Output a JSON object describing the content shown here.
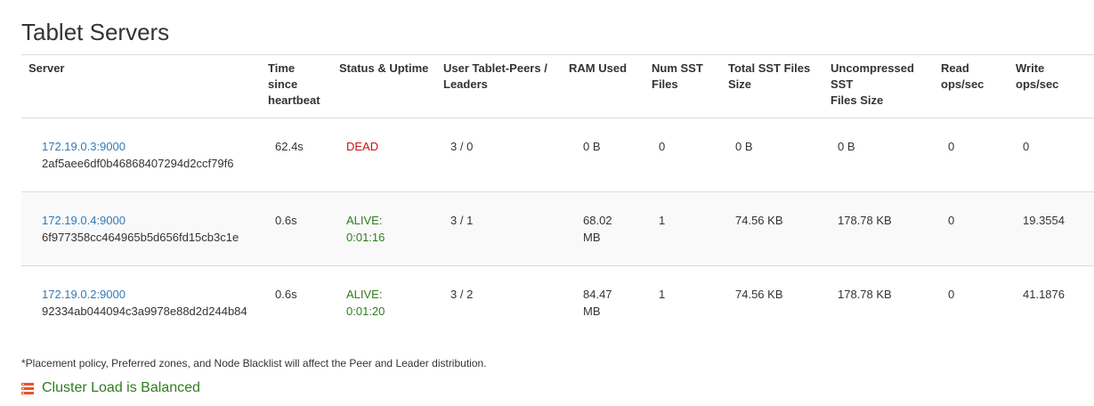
{
  "page": {
    "title": "Tablet Servers"
  },
  "table": {
    "headers": {
      "server": "Server",
      "heartbeat_1": "Time",
      "heartbeat_2": "since",
      "heartbeat_3": "heartbeat",
      "status": "Status & Uptime",
      "peers_1": "User Tablet-Peers /",
      "peers_2": "Leaders",
      "ram": "RAM Used",
      "num_sst_1": "Num SST",
      "num_sst_2": "Files",
      "total_sst_1": "Total SST Files",
      "total_sst_2": "Size",
      "uncomp_1": "Uncompressed",
      "uncomp_2": "SST",
      "uncomp_3": "Files Size",
      "read_1": "Read",
      "read_2": "ops/sec",
      "write_1": "Write",
      "write_2": "ops/sec"
    },
    "rows": [
      {
        "address": "172.19.0.3:9000",
        "uuid": "2af5aee6df0b46868407294d2ccf79f6",
        "heartbeat": "62.4s",
        "status_1": "DEAD",
        "status_2": "",
        "peers": "3 / 0",
        "ram_1": "0 B",
        "ram_2": "",
        "num_sst": "0",
        "total_sst": "0 B",
        "uncompressed": "0 B",
        "read_ops": "0",
        "write_ops": "0"
      },
      {
        "address": "172.19.0.4:9000",
        "uuid": "6f977358cc464965b5d656fd15cb3c1e",
        "heartbeat": "0.6s",
        "status_1": "ALIVE:",
        "status_2": "0:01:16",
        "peers": "3 / 1",
        "ram_1": "68.02",
        "ram_2": "MB",
        "num_sst": "1",
        "total_sst": "74.56 KB",
        "uncompressed": "178.78 KB",
        "read_ops": "0",
        "write_ops": "19.3554"
      },
      {
        "address": "172.19.0.2:9000",
        "uuid": "92334ab044094c3a9978e88d2d244b84",
        "heartbeat": "0.6s",
        "status_1": "ALIVE:",
        "status_2": "0:01:20",
        "peers": "3 / 2",
        "ram_1": "84.47",
        "ram_2": "MB",
        "num_sst": "1",
        "total_sst": "74.56 KB",
        "uncompressed": "178.78 KB",
        "read_ops": "0",
        "write_ops": "41.1876"
      }
    ]
  },
  "footnote": "*Placement policy, Preferred zones, and Node Blacklist will affect the Peer and Leader distribution.",
  "balance": {
    "icon": "server-stack-icon",
    "text": "Cluster Load is Balanced"
  },
  "colors": {
    "link": "#337ab7",
    "dead": "#cc1111",
    "alive": "#2e7d1e",
    "row_stripe": "#f9f9f9",
    "border": "#dddddd",
    "icon": "#e8552a"
  }
}
